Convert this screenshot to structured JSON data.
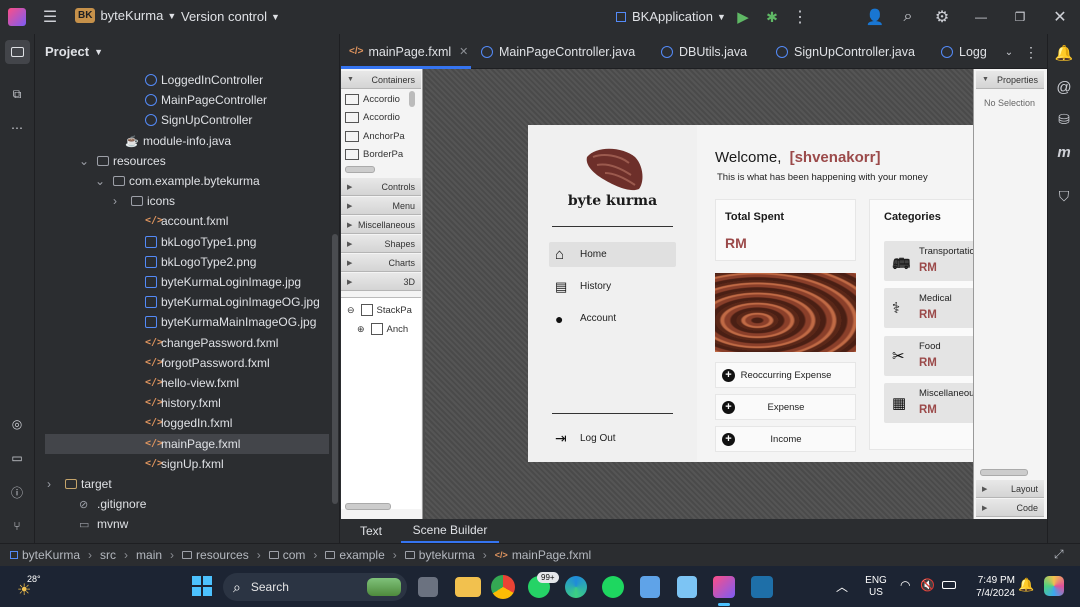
{
  "titlebar": {
    "project_badge": "BK",
    "project_name": "byteKurma",
    "vcs": "Version control",
    "run_config": "BKApplication"
  },
  "sidebar": {
    "title": "Project",
    "items": [
      {
        "label": "LoggedInController",
        "kind": "class"
      },
      {
        "label": "MainPageController",
        "kind": "class"
      },
      {
        "label": "SignUpController",
        "kind": "class"
      },
      {
        "label": "module-info.java",
        "kind": "java"
      },
      {
        "label": "resources",
        "kind": "folder"
      },
      {
        "label": "com.example.bytekurma",
        "kind": "folder"
      },
      {
        "label": "icons",
        "kind": "folder"
      },
      {
        "label": "account.fxml",
        "kind": "xml"
      },
      {
        "label": "bkLogoType1.png",
        "kind": "image"
      },
      {
        "label": "bkLogoType2.png",
        "kind": "image"
      },
      {
        "label": "byteKurmaLoginImage.jpg",
        "kind": "image"
      },
      {
        "label": "byteKurmaLoginImageOG.jpg",
        "kind": "image"
      },
      {
        "label": "byteKurmaMainImageOG.jpg",
        "kind": "image"
      },
      {
        "label": "changePassword.fxml",
        "kind": "xml"
      },
      {
        "label": "forgotPassword.fxml",
        "kind": "xml"
      },
      {
        "label": "hello-view.fxml",
        "kind": "xml"
      },
      {
        "label": "history.fxml",
        "kind": "xml"
      },
      {
        "label": "loggedIn.fxml",
        "kind": "xml"
      },
      {
        "label": "mainPage.fxml",
        "kind": "xml"
      },
      {
        "label": "signUp.fxml",
        "kind": "xml"
      },
      {
        "label": "target",
        "kind": "folder-orange"
      },
      {
        "label": ".gitignore",
        "kind": "ignore"
      },
      {
        "label": "mvnw",
        "kind": "file"
      }
    ]
  },
  "tabs": [
    {
      "label": "mainPage.fxml"
    },
    {
      "label": "MainPageController.java"
    },
    {
      "label": "DBUtils.java"
    },
    {
      "label": "SignUpController.java"
    },
    {
      "label": "Logg"
    }
  ],
  "scene_builder": {
    "library": {
      "containers": "Containers",
      "items": [
        "Accordio",
        "Accordio",
        "AnchorPa",
        "BorderPa"
      ],
      "sections": [
        "Controls",
        "Menu",
        "Miscellaneous",
        "Shapes",
        "Charts",
        "3D"
      ]
    },
    "hierarchy": [
      "StackPa",
      "Anch"
    ],
    "properties": {
      "title": "Properties",
      "empty": "No Selection",
      "layout": "Layout",
      "code": "Code"
    }
  },
  "app": {
    "logo_text": "byte kurma",
    "nav": [
      {
        "label": "Home",
        "icon": "home-icon"
      },
      {
        "label": "History",
        "icon": "history-icon"
      },
      {
        "label": "Account",
        "icon": "account-icon"
      }
    ],
    "logout": "Log Out",
    "welcome": "Welcome,",
    "username": "[shvenakorr]",
    "subtitle": "This is what has been happening with your money",
    "total_spent_title": "Total Spent",
    "total_spent_value": "RM",
    "actions": [
      "Reoccurring Expense",
      "Expense",
      "Income"
    ],
    "categories_title": "Categories",
    "categories": [
      {
        "name": "Transportation",
        "value": "RM",
        "icon": "bus-icon"
      },
      {
        "name": "Medical",
        "value": "RM",
        "icon": "medical-icon"
      },
      {
        "name": "Food",
        "value": "RM",
        "icon": "utensils-icon"
      },
      {
        "name": "Miscellaneous",
        "value": "RM",
        "icon": "box-icon"
      }
    ],
    "accent": "#9b4a4a"
  },
  "bottom_tabs": [
    "Text",
    "Scene Builder"
  ],
  "breadcrumb": [
    "byteKurma",
    "src",
    "main",
    "resources",
    "com",
    "example",
    "bytekurma",
    "mainPage.fxml"
  ],
  "taskbar": {
    "weather": "28°",
    "search": "Search",
    "badge": "99+",
    "lang": "ENG",
    "region": "US",
    "time": "7:49 PM",
    "date": "7/4/2024"
  }
}
